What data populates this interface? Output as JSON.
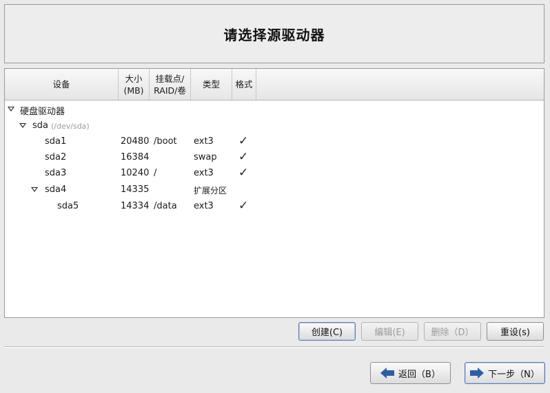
{
  "header": {
    "title": "请选择源驱动器"
  },
  "table": {
    "columns": {
      "device": "设备",
      "size_line1": "大小",
      "size_line2": "(MB)",
      "mount_line1": "挂载点/",
      "mount_line2": "RAID/卷",
      "type": "类型",
      "format": "格式"
    },
    "group": {
      "label": "硬盘驱动器"
    },
    "disk": {
      "name": "sda",
      "path": "(/dev/sda)"
    },
    "rows": [
      {
        "device": "sda1",
        "size": "20480",
        "mount": "/boot",
        "type": "ext3",
        "format": "✓"
      },
      {
        "device": "sda2",
        "size": "16384",
        "mount": "",
        "type": "swap",
        "format": "✓"
      },
      {
        "device": "sda3",
        "size": "10240",
        "mount": "/",
        "type": "ext3",
        "format": "✓"
      },
      {
        "device": "sda4",
        "size": "14335",
        "mount": "",
        "type": "扩展分区",
        "format": ""
      },
      {
        "device": "sda5",
        "size": "14334",
        "mount": "/data",
        "type": "ext3",
        "format": "✓"
      }
    ]
  },
  "actions": {
    "create": "创建(C)",
    "edit": "编辑(E)",
    "delete": "删除（D）",
    "reset": "重设(s)"
  },
  "nav": {
    "back": "返回（B）",
    "next": "下一步（N）"
  }
}
